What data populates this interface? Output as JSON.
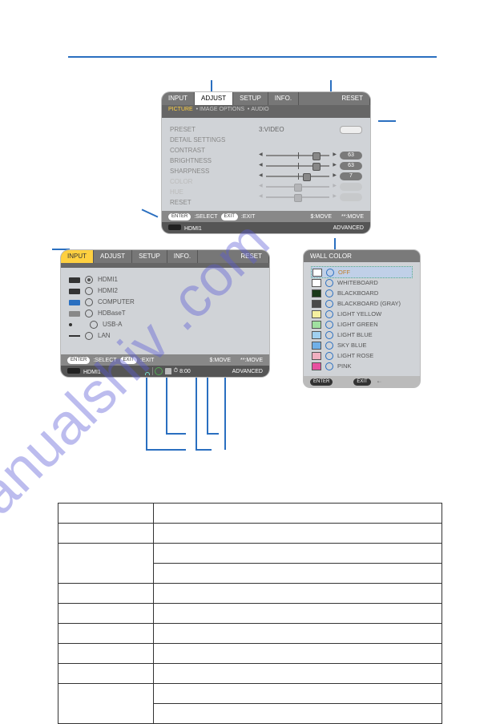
{
  "watermark": "manualshiv .com",
  "osd1": {
    "tabs": {
      "input": "INPUT",
      "adjust": "ADJUST",
      "setup": "SETUP",
      "info": "INFO.",
      "reset": "RESET"
    },
    "subtabs": {
      "picture": "PICTURE",
      "imgopt": "IMAGE OPTIONS",
      "audio": "AUDIO"
    },
    "labels": [
      "PRESET",
      "DETAIL SETTINGS",
      "CONTRAST",
      "BRIGHTNESS",
      "SHARPNESS",
      "COLOR",
      "HUE",
      "RESET"
    ],
    "source_mode": "3:VIDEO",
    "sliders": [
      {
        "name": "contrast",
        "val": "63",
        "pct": 80
      },
      {
        "name": "brightness",
        "val": "63",
        "pct": 80
      },
      {
        "name": "sharpness",
        "val": "7",
        "pct": 65
      }
    ],
    "dim_sliders": [
      {
        "name": "color"
      },
      {
        "name": "hue"
      }
    ],
    "footer": {
      "enter": "ENTER",
      "select": ":SELECT",
      "exit": "EXIT",
      "exit_act": ":EXIT",
      "move1": "$:MOVE",
      "move2": "**:MOVE"
    },
    "srcbar": {
      "label": "HDMI1",
      "advanced": "ADVANCED"
    }
  },
  "osd2": {
    "tabs": {
      "input": "INPUT",
      "adjust": "ADJUST",
      "setup": "SETUP",
      "info": "INFO.",
      "reset": "RESET"
    },
    "items": [
      {
        "label": "HDMI1",
        "icon": "port",
        "sel": true
      },
      {
        "label": "HDMI2",
        "icon": "port"
      },
      {
        "label": "COMPUTER",
        "icon": "blue"
      },
      {
        "label": "HDBaseT",
        "icon": "grey"
      },
      {
        "label": "USB-A",
        "icon": "dot"
      },
      {
        "label": "LAN",
        "icon": "line"
      }
    ],
    "footer": {
      "enter": "ENTER",
      "select": ":SELECT",
      "exit": "EXIT",
      "exit_act": ":EXIT",
      "move1": "$:MOVE",
      "move2": "**:MOVE"
    },
    "srcbar": {
      "label": "HDMI1",
      "clock": "8:00",
      "advanced": "ADVANCED"
    }
  },
  "wc": {
    "title": "WALL COLOR",
    "items": [
      {
        "label": "OFF",
        "color": "#ffffff",
        "sel": true
      },
      {
        "label": "WHITEBOARD",
        "color": "#ffffff"
      },
      {
        "label": "BLACKBOARD",
        "color": "#1a3a1a"
      },
      {
        "label": "BLACKBOARD (GRAY)",
        "color": "#4a4a4a"
      },
      {
        "label": "LIGHT YELLOW",
        "color": "#f5f0a0"
      },
      {
        "label": "LIGHT GREEN",
        "color": "#a0e0a0"
      },
      {
        "label": "LIGHT BLUE",
        "color": "#a0d0f0"
      },
      {
        "label": "SKY BLUE",
        "color": "#70b0e8"
      },
      {
        "label": "LIGHT ROSE",
        "color": "#f0b0c0"
      },
      {
        "label": "PINK",
        "color": "#e850a0"
      }
    ],
    "footer": {
      "enter": "ENTER",
      "exit": "EXIT"
    }
  }
}
